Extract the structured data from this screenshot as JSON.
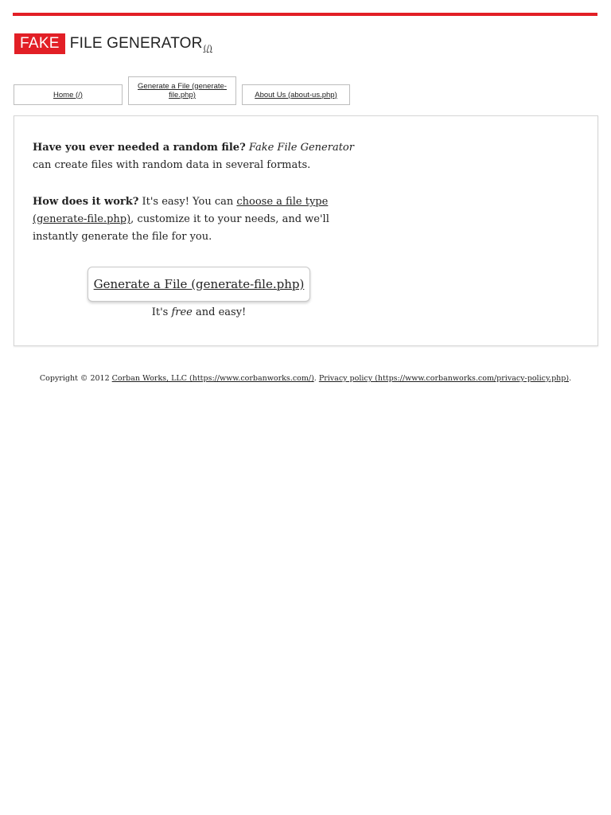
{
  "brand": {
    "fake_label": "FAKE",
    "rest_label": "FILE GENERATOR",
    "home_link": "(/)",
    "accent_color": "#e21f26"
  },
  "nav": {
    "tabs": [
      {
        "label": "Home (/)"
      },
      {
        "label": "Generate a File (generate-file.php)"
      },
      {
        "label": "About Us (about-us.php)"
      }
    ]
  },
  "main": {
    "intro": {
      "question": "Have you ever needed a random file?",
      "product_name": "Fake File Generator",
      "text": " can create files with random data in several formats."
    },
    "how": {
      "question": "How does it work?",
      "text_before": " It's easy! You can ",
      "link": "choose a file type (generate-file.php)",
      "text_after": ", customize it to your needs, and we'll instantly generate the file for you."
    },
    "cta": {
      "label": "Generate a File (generate-file.php)",
      "note_before": "It's ",
      "note_emphasis": "free",
      "note_after": " and easy!"
    }
  },
  "footer": {
    "copyright": "Copyright © 2012 ",
    "company_link": "Corban Works, LLC (https://www.corbanworks.com/)",
    "separator": ". ",
    "privacy_link": "Privacy policy (https://www.corbanworks.com/privacy-policy.php)",
    "end": "."
  }
}
